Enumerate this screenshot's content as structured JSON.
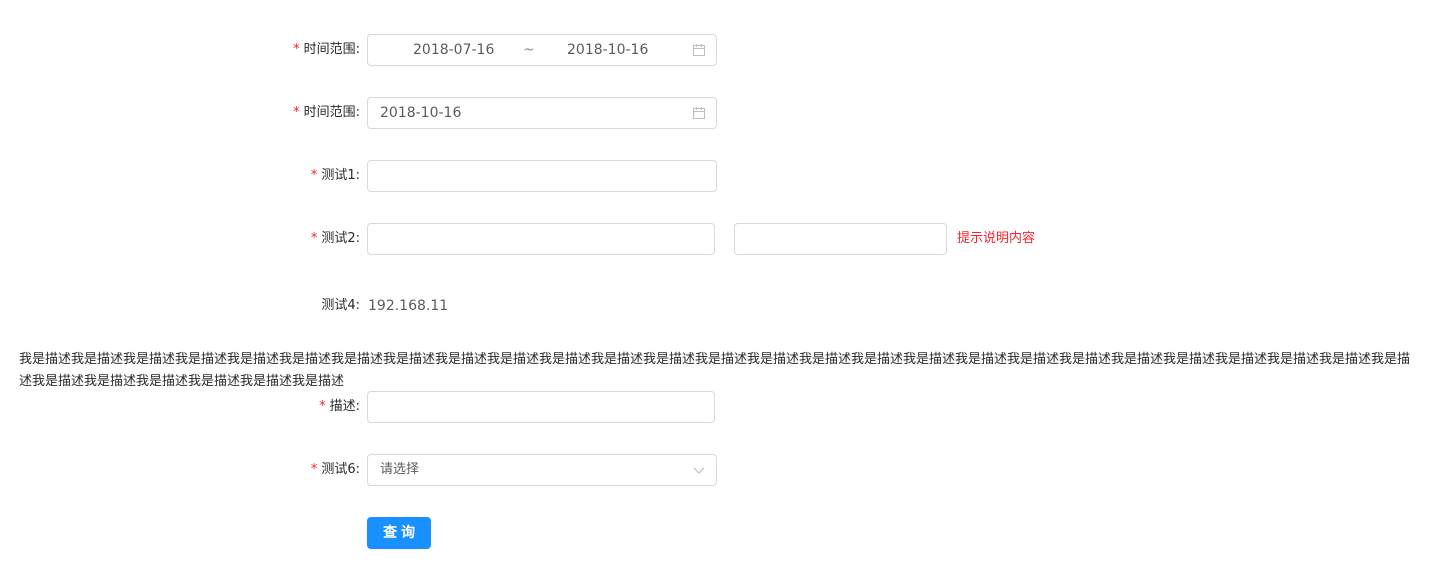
{
  "form": {
    "date_range": {
      "label": "时间范围",
      "required": "*",
      "start": "2018-07-16",
      "separator": "~",
      "end": "2018-10-16",
      "icon": "calendar-icon"
    },
    "date_single": {
      "label": "时间范围",
      "required": "*",
      "value": "2018-10-16",
      "icon": "calendar-icon"
    },
    "test1": {
      "label": "测试1",
      "required": "*",
      "value": ""
    },
    "test2": {
      "label": "测试2",
      "required": "*",
      "value_a": "",
      "value_b": "",
      "hint": "提示说明内容"
    },
    "test4": {
      "label": "测试4",
      "value": "192.168.11"
    },
    "description_text": "我是描述我是描述我是描述我是描述我是描述我是描述我是描述我是描述我是描述我是描述我是描述我是描述我是描述我是描述我是描述我是描述我是描述我是描述我是描述我是描述我是描述我是描述我是描述我是描述我是描述我是描述我是描述我是描述我是描述我是描述我是描述我是描述我是描述",
    "describe": {
      "label": "描述",
      "required": "*",
      "value": ""
    },
    "test6": {
      "label": "测试6",
      "required": "*",
      "placeholder": "请选择",
      "icon": "chevron-down-icon"
    },
    "submit_label": "查询"
  },
  "colors": {
    "primary": "#1890ff",
    "required": "#f5222d",
    "border": "#d9d9d9"
  }
}
